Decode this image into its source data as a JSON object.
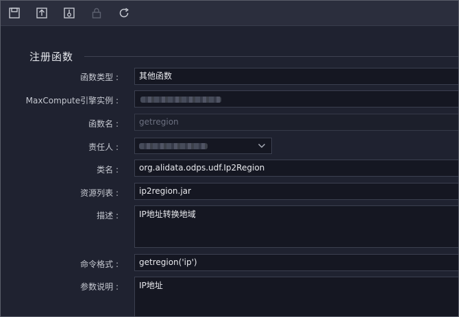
{
  "toolbar": {
    "buttons": [
      {
        "icon": "save-icon"
      },
      {
        "icon": "upload-icon"
      },
      {
        "icon": "submit-icon"
      },
      {
        "icon": "lock-icon"
      },
      {
        "icon": "refresh-icon"
      }
    ]
  },
  "section": {
    "title": "注册函数"
  },
  "form": {
    "function_type": {
      "label": "函数类型 :",
      "value": "其他函数"
    },
    "engine": {
      "label": "MaxCompute引擎实例 :",
      "value": ""
    },
    "function_name": {
      "label": "函数名 :",
      "value": "getregion"
    },
    "owner": {
      "label": "责任人 :",
      "value": ""
    },
    "class_name": {
      "label": "类名 :",
      "value": "org.alidata.odps.udf.Ip2Region"
    },
    "resources": {
      "label": "资源列表 :",
      "value": "ip2region.jar"
    },
    "description": {
      "label": "描述 :",
      "value": "IP地址转换地域"
    },
    "command": {
      "label": "命令格式 :",
      "value": "getregion('ip')"
    },
    "params": {
      "label": "参数说明 :",
      "value": "IP地址"
    }
  },
  "colors": {
    "background": "#1f2230",
    "toolbar": "#2b2e3d",
    "field": "#151722"
  }
}
